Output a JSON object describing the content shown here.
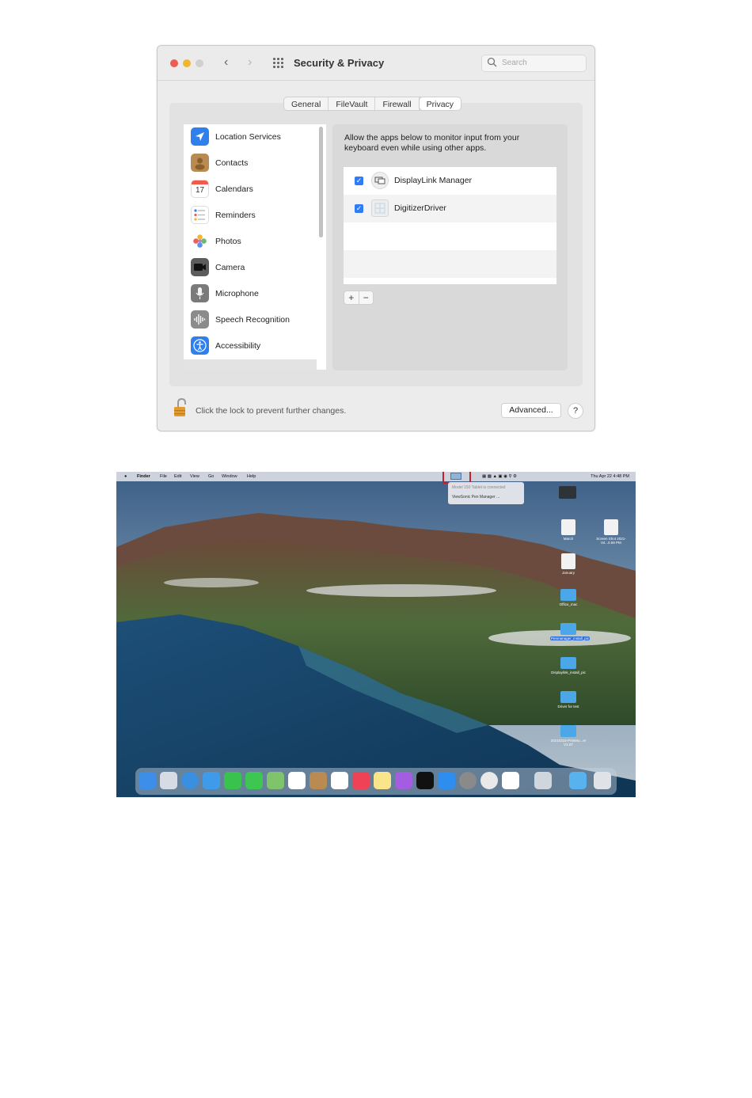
{
  "window": {
    "title": "Security & Privacy",
    "search_placeholder": "Search",
    "tabs": [
      "General",
      "FileVault",
      "Firewall",
      "Privacy"
    ],
    "active_tab": "Privacy",
    "sidebar_items": [
      {
        "label": "Location Services",
        "icon": "location-arrow-icon",
        "color": "#2f80ed"
      },
      {
        "label": "Contacts",
        "icon": "contacts-book-icon",
        "color": "#b98a52"
      },
      {
        "label": "Calendars",
        "icon": "calendar-icon",
        "color": "#ffffff",
        "day": "17"
      },
      {
        "label": "Reminders",
        "icon": "reminders-list-icon",
        "color": "#ffffff"
      },
      {
        "label": "Photos",
        "icon": "photos-flower-icon",
        "color": "#ffffff"
      },
      {
        "label": "Camera",
        "icon": "camera-icon",
        "color": "#5c5c5c"
      },
      {
        "label": "Microphone",
        "icon": "microphone-icon",
        "color": "#7a7a7a"
      },
      {
        "label": "Speech Recognition",
        "icon": "waveform-icon",
        "color": "#8b8b8b"
      },
      {
        "label": "Accessibility",
        "icon": "accessibility-icon",
        "color": "#2f80ed"
      }
    ],
    "description": "Allow the apps below to monitor input from your keyboard even while using other apps.",
    "apps": [
      {
        "name": "DisplayLink Manager",
        "checked": true
      },
      {
        "name": "DigitizerDriver",
        "checked": true
      }
    ],
    "add_label": "+",
    "remove_label": "−",
    "lock_text": "Click the lock to prevent further changes.",
    "advanced_label": "Advanced...",
    "help_label": "?"
  },
  "desktop": {
    "menubar": {
      "apple": "",
      "items": [
        "Finder",
        "File",
        "Edit",
        "View",
        "Go",
        "Window",
        "Help"
      ],
      "clock": "Thu Apr 22  4:48 PM"
    },
    "tray_popup": {
      "line1": "Model 150 Tablet is connected",
      "line2": "ViewSonic Pen Manager ..."
    },
    "icons": [
      {
        "label": "March",
        "kind": "doc"
      },
      {
        "label": "Screen Shot 2021-04...0.59 PM",
        "kind": "doc"
      },
      {
        "label": "January",
        "kind": "doc"
      },
      {
        "label": "Office_mac",
        "kind": "folder"
      },
      {
        "label": "Penmanager_install_pic",
        "kind": "folder"
      },
      {
        "label": "Displaylink_install_pic",
        "kind": "folder"
      },
      {
        "label": "Driver for test",
        "kind": "folder"
      },
      {
        "label": "20210315-Printeto...er V1.07",
        "kind": "folder"
      }
    ],
    "dock_app_count": 22
  }
}
